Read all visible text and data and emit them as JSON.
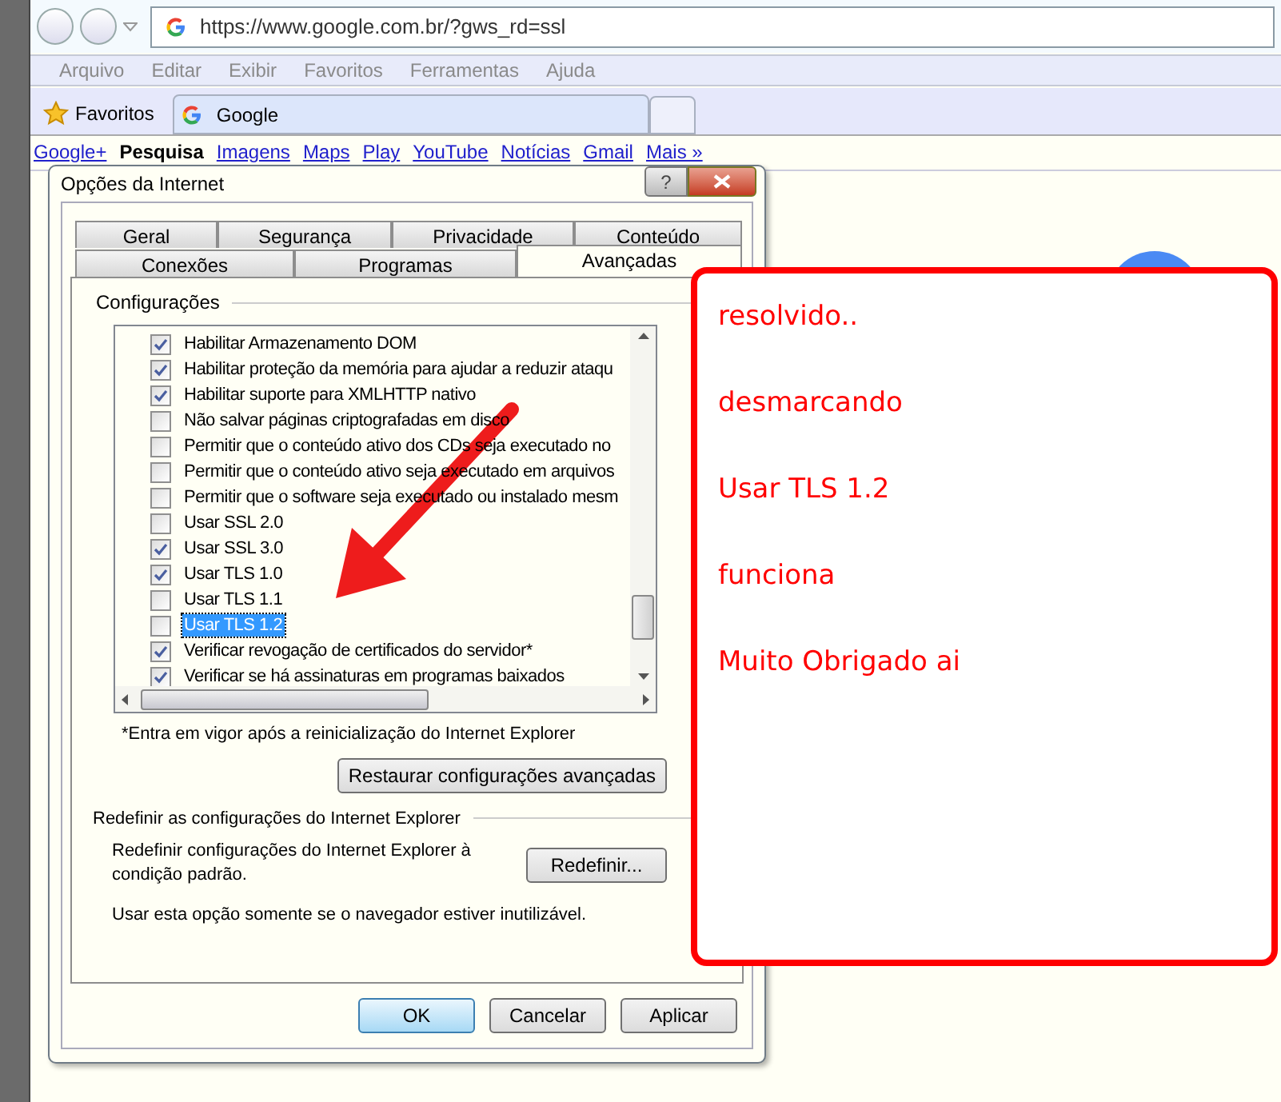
{
  "browser": {
    "address": "https://www.google.com.br/?gws_rd=ssl",
    "menu": [
      "Arquivo",
      "Editar",
      "Exibir",
      "Favoritos",
      "Ferramentas",
      "Ajuda"
    ],
    "favorites": "Favoritos",
    "tab": "Google",
    "links": [
      {
        "label": "Google+",
        "selected": false
      },
      {
        "label": "Pesquisa",
        "selected": true
      },
      {
        "label": "Imagens",
        "selected": false
      },
      {
        "label": "Maps",
        "selected": false
      },
      {
        "label": "Play",
        "selected": false
      },
      {
        "label": "YouTube",
        "selected": false
      },
      {
        "label": "Notícias",
        "selected": false
      },
      {
        "label": "Gmail",
        "selected": false
      },
      {
        "label": "Mais »",
        "selected": false
      }
    ]
  },
  "dialog": {
    "title": "Opções da Internet",
    "help": "?",
    "tab_rows": [
      [
        {
          "label": "Geral",
          "selected": false
        },
        {
          "label": "Segurança",
          "selected": false
        },
        {
          "label": "Privacidade",
          "selected": false
        },
        {
          "label": "Conteúdo",
          "selected": false
        }
      ],
      [
        {
          "label": "Conexões",
          "selected": false
        },
        {
          "label": "Programas",
          "selected": false
        },
        {
          "label": "Avançadas",
          "selected": true
        }
      ]
    ],
    "group": "Configurações",
    "settings": [
      {
        "label": "Habilitar Armazenamento DOM",
        "checked": true,
        "selected": false
      },
      {
        "label": "Habilitar proteção da memória para ajudar a reduzir ataqu",
        "checked": true,
        "selected": false
      },
      {
        "label": "Habilitar suporte para XMLHTTP nativo",
        "checked": true,
        "selected": false
      },
      {
        "label": "Não salvar páginas criptografadas em disco",
        "checked": false,
        "selected": false
      },
      {
        "label": "Permitir que o conteúdo ativo dos CDs seja executado no",
        "checked": false,
        "selected": false
      },
      {
        "label": "Permitir que o conteúdo ativo seja executado em arquivos",
        "checked": false,
        "selected": false
      },
      {
        "label": "Permitir que o software seja executado ou instalado mesm",
        "checked": false,
        "selected": false
      },
      {
        "label": "Usar SSL 2.0",
        "checked": false,
        "selected": false
      },
      {
        "label": "Usar SSL 3.0",
        "checked": true,
        "selected": false
      },
      {
        "label": "Usar TLS 1.0",
        "checked": true,
        "selected": false
      },
      {
        "label": "Usar TLS 1.1",
        "checked": false,
        "selected": false
      },
      {
        "label": "Usar TLS 1.2",
        "checked": false,
        "selected": true
      },
      {
        "label": "Verificar revogação de certificados do servidor*",
        "checked": true,
        "selected": false
      },
      {
        "label": "Verificar se há assinaturas em programas baixados",
        "checked": true,
        "selected": false
      }
    ],
    "footnote": "*Entra em vigor após a reinicialização do Internet Explorer",
    "restore_button": "Restaurar configurações avançadas",
    "reset_group": "Redefinir as configurações do Internet Explorer",
    "reset_text": "Redefinir configurações do Internet Explorer à condição padrão.",
    "reset_button": "Redefinir...",
    "warning": "Usar esta opção somente se o navegador estiver inutilizável.",
    "buttons": [
      "OK",
      "Cancelar",
      "Aplicar"
    ]
  },
  "note": [
    "resolvido..",
    "desmarcando",
    "Usar TLS 1.2",
    "funciona",
    "Muito Obrigado ai"
  ]
}
